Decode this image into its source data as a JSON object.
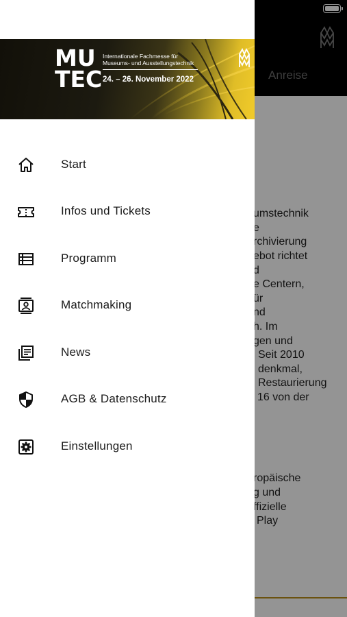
{
  "background": {
    "tab_label": "Anreise",
    "text_lines": [
      "umstechnik",
      "e",
      "rchivierung",
      "ebot richtet",
      "d",
      "e Centern,",
      "ür",
      "nd",
      "h. Im",
      "gen und",
      "Seit 2010",
      "denkmal,",
      "Restaurierung",
      "16 von der",
      "ropäische",
      "g und",
      "ffizielle",
      "Play"
    ]
  },
  "banner": {
    "logo_top": "MU",
    "logo_bottom": "TEC",
    "tagline_1": "Internationale Fachmesse für",
    "tagline_2": "Museums- und Ausstellungstechnik",
    "dates": "24. – 26. November 2022"
  },
  "menu": {
    "items": [
      {
        "label": "Start",
        "icon": "home-icon"
      },
      {
        "label": "Infos und Tickets",
        "icon": "ticket-icon"
      },
      {
        "label": "Programm",
        "icon": "list-icon"
      },
      {
        "label": "Matchmaking",
        "icon": "contact-card-icon"
      },
      {
        "label": "News",
        "icon": "news-icon"
      },
      {
        "label": "AGB & Datenschutz",
        "icon": "shield-icon"
      },
      {
        "label": "Einstellungen",
        "icon": "settings-icon"
      }
    ]
  },
  "colors": {
    "accent_gold": "#f1cb2a",
    "topbar": "#000000",
    "drawer_bg": "#ffffff"
  }
}
